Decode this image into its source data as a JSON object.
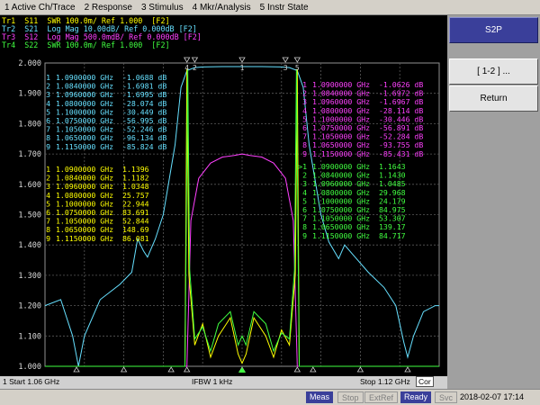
{
  "menu": [
    "1 Active Ch/Trace",
    "2 Response",
    "3 Stimulus",
    "4 Mkr/Analysis",
    "5 Instr State"
  ],
  "traces": [
    {
      "label": "Tr1  S11  SWR 100.0m/ Ref 1.000  [F2]",
      "color": "#ffff00"
    },
    {
      "label": "Tr2  S21  Log Mag 10.00dB/ Ref 0.000dB [F2]",
      "color": "#66e0ff"
    },
    {
      "label": "Tr3  S12  Log Mag 500.0mdB/ Ref 0.000dB [F2]",
      "color": "#ff40ff"
    },
    {
      "label": "Tr4  S22  SWR 100.0m/ Ref 1.000  [F2]",
      "color": "#40ff40",
      "active": true
    }
  ],
  "y_ticks": [
    "2.000",
    "1.900",
    "1.800",
    "1.700",
    "1.600",
    "1.500",
    "1.400",
    "1.300",
    "1.200",
    "1.100",
    "1.000"
  ],
  "marker_tables": {
    "s21": [
      {
        "n": "1",
        "f": "1.0900000 GHz",
        "v": "-1.0688 dB"
      },
      {
        "n": "2",
        "f": "1.0840000 GHz",
        "v": "-1.6981 dB"
      },
      {
        "n": "3",
        "f": "1.0960000 GHz",
        "v": "-1.6995 dB"
      },
      {
        "n": "4",
        "f": "1.0800000 GHz",
        "v": "-28.074 dB"
      },
      {
        "n": "5",
        "f": "1.1000000 GHz",
        "v": "-30.449 dB"
      },
      {
        "n": "6",
        "f": "1.0750000 GHz",
        "v": "-56.995 dB"
      },
      {
        "n": "7",
        "f": "1.1050000 GHz",
        "v": "-52.246 dB"
      },
      {
        "n": "8",
        "f": "1.0650000 GHz",
        "v": "-96.134 dB"
      },
      {
        "n": "9",
        "f": "1.1150000 GHz",
        "v": "-85.824 dB"
      }
    ],
    "s11": [
      {
        "n": "1",
        "f": "1.0900000 GHz",
        "v": "1.1396"
      },
      {
        "n": "2",
        "f": "1.0840000 GHz",
        "v": "1.1182"
      },
      {
        "n": "3",
        "f": "1.0960000 GHz",
        "v": "1.0348"
      },
      {
        "n": "4",
        "f": "1.0800000 GHz",
        "v": "25.757"
      },
      {
        "n": "5",
        "f": "1.1000000 GHz",
        "v": "22.944"
      },
      {
        "n": "6",
        "f": "1.0750000 GHz",
        "v": "83.691"
      },
      {
        "n": "7",
        "f": "1.1050000 GHz",
        "v": "52.844"
      },
      {
        "n": "8",
        "f": "1.0650000 GHz",
        "v": "148.69"
      },
      {
        "n": "9",
        "f": "1.1150000 GHz",
        "v": "86.081"
      }
    ],
    "s12": [
      {
        "n": "1",
        "f": "1.0900000 GHz",
        "v": "-1.0626 dB"
      },
      {
        "n": "2",
        "f": "1.0840000 GHz",
        "v": "-1.6972 dB"
      },
      {
        "n": "3",
        "f": "1.0960000 GHz",
        "v": "-1.6967 dB"
      },
      {
        "n": "4",
        "f": "1.0800000 GHz",
        "v": "-28.114 dB"
      },
      {
        "n": "5",
        "f": "1.1000000 GHz",
        "v": "-30.446 dB"
      },
      {
        "n": "6",
        "f": "1.0750000 GHz",
        "v": "-56.891 dB"
      },
      {
        "n": "7",
        "f": "1.1050000 GHz",
        "v": "-52.284 dB"
      },
      {
        "n": "8",
        "f": "1.0650000 GHz",
        "v": "-93.755 dB"
      },
      {
        "n": "9",
        "f": "1.1150000 GHz",
        "v": "-85.431 dB"
      }
    ],
    "s22": [
      {
        "n": ">1",
        "f": "1.0900000 GHz",
        "v": "1.1643"
      },
      {
        "n": "2",
        "f": "1.0840000 GHz",
        "v": "1.1430"
      },
      {
        "n": "3",
        "f": "1.0960000 GHz",
        "v": "1.0485"
      },
      {
        "n": "4",
        "f": "1.0800000 GHz",
        "v": "29.968"
      },
      {
        "n": "5",
        "f": "1.1000000 GHz",
        "v": "24.179"
      },
      {
        "n": "6",
        "f": "1.0750000 GHz",
        "v": "84.975"
      },
      {
        "n": "7",
        "f": "1.1050000 GHz",
        "v": "53.307"
      },
      {
        "n": "8",
        "f": "1.0650000 GHz",
        "v": "139.17"
      },
      {
        "n": "9",
        "f": "1.1150000 GHz",
        "v": "84.717"
      }
    ]
  },
  "channel": {
    "start": "1  Start 1.06 GHz",
    "ifbw": "IFBW 1 kHz",
    "stop": "Stop 1.12 GHz",
    "cor": "Cor"
  },
  "softkeys": {
    "title": "S2P",
    "pair": "[ 1-2 ] ...",
    "return": "Return"
  },
  "status": {
    "meas": "Meas",
    "stop": "Stop",
    "extref": "ExtRef",
    "ready": "Ready",
    "svc": "Svc",
    "datetime": "2018-02-07 17:14"
  },
  "colors": {
    "s11": "#ffff00",
    "s21": "#66e0ff",
    "s12": "#ff40ff",
    "s22": "#40ff40",
    "grid": "#5a5a5a",
    "active_key": "#3a3f9a"
  }
}
